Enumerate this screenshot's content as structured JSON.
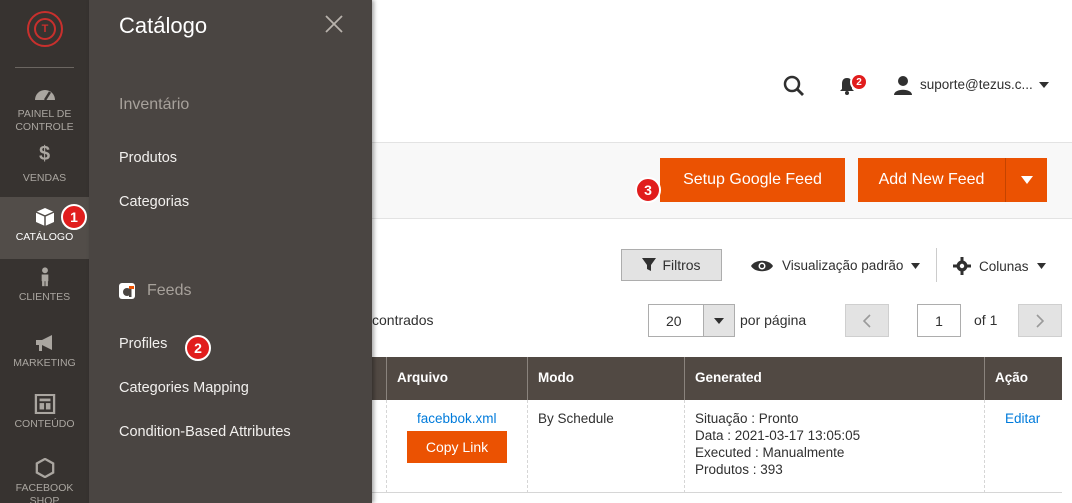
{
  "colors": {
    "rail_bg": "#373330",
    "panel_bg": "#4a4542",
    "accent": "#eb5202",
    "badge": "#e11d1d",
    "table_header": "#514943",
    "link": "#007bdb"
  },
  "rail": {
    "items": [
      {
        "label_line1": "PAINEL DE",
        "label_line2": "CONTROLE",
        "icon": "speedometer-icon"
      },
      {
        "label_line1": "VENDAS",
        "label_line2": "",
        "icon": "dollar-icon"
      },
      {
        "label_line1": "CATÁLOGO",
        "label_line2": "",
        "icon": "box-icon"
      },
      {
        "label_line1": "CLIENTES",
        "label_line2": "",
        "icon": "person-icon"
      },
      {
        "label_line1": "MARKETING",
        "label_line2": "",
        "icon": "megaphone-icon"
      },
      {
        "label_line1": "CONTEÚDO",
        "label_line2": "",
        "icon": "layout-icon"
      },
      {
        "label_line1": "FACEBOOK",
        "label_line2": "SHOP",
        "icon": "hexagon-icon"
      }
    ]
  },
  "panel": {
    "title": "Catálogo",
    "section_inventory": "Inventário",
    "link_products": "Produtos",
    "link_categories": "Categorias",
    "section_feeds": "Feeds",
    "link_profiles": "Profiles",
    "link_categories_mapping": "Categories Mapping",
    "link_condition_attributes": "Condition-Based Attributes"
  },
  "badges": {
    "rail_catalog": "1",
    "panel_profiles": "2",
    "setup_feed": "3"
  },
  "header": {
    "notifications_count": "2",
    "user": "suporte@tezus.c..."
  },
  "actions": {
    "setup_google_feed": "Setup Google Feed",
    "add_new_feed": "Add New Feed"
  },
  "grid_toolbar": {
    "filters": "Filtros",
    "default_view": "Visualização padrão",
    "columns": "Colunas",
    "records_found": "contrados",
    "per_page_value": "20",
    "per_page_label": "por página",
    "current_page": "1",
    "of_pages": "of 1"
  },
  "table": {
    "headers": [
      "Arquivo",
      "Modo",
      "Generated",
      "Ação"
    ],
    "rows": [
      {
        "file": "facebbok.xml",
        "copy_link": "Copy Link",
        "mode": "By Schedule",
        "generated": {
          "status": "Situação : Pronto",
          "date": "Data : 2021-03-17 13:05:05",
          "executed": "Executed : Manualmente",
          "products": "Produtos : 393"
        },
        "action": "Editar"
      }
    ]
  }
}
